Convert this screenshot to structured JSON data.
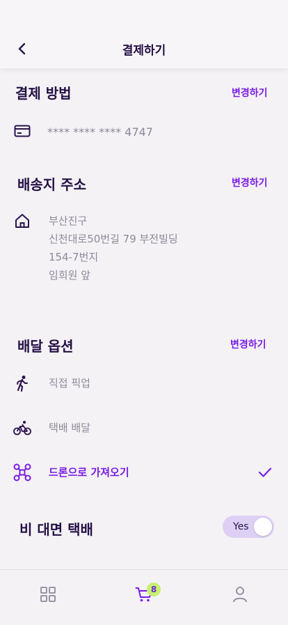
{
  "header": {
    "title": "결제하기",
    "back_icon": "chevron-left-icon"
  },
  "payment": {
    "title": "결제 방법",
    "change_label": "변경하기",
    "card_icon": "credit-card-icon",
    "card_number": "**** **** **** 4747"
  },
  "shipping": {
    "title": "배송지 주소",
    "change_label": "변경하기",
    "home_icon": "home-icon",
    "address_lines": [
      "부산진구",
      "신천대로50번길 79 부전빌딩",
      "154-7번지",
      "임희원 앞"
    ]
  },
  "delivery": {
    "title": "배달 옵션",
    "change_label": "변경하기",
    "options": [
      {
        "label": "직접 픽업",
        "icon": "walking-person-icon",
        "selected": false
      },
      {
        "label": "택배 배달",
        "icon": "bicycle-icon",
        "selected": false
      },
      {
        "label": "드론으로 가져오기",
        "icon": "drone-icon",
        "selected": true
      }
    ],
    "check_icon": "checkmark-icon"
  },
  "contactless": {
    "label": "비 대면 택배",
    "toggle_label": "Yes",
    "enabled": true
  },
  "tabbar": {
    "items": [
      {
        "icon": "grid-icon"
      },
      {
        "icon": "cart-icon",
        "active": true
      },
      {
        "icon": "user-icon"
      }
    ],
    "cart_badge": "8"
  },
  "colors": {
    "accent": "#7a1ce6",
    "text_dark": "#230f45",
    "text_muted": "#8c8a99",
    "badge": "#c6f06e",
    "toggle_bg": "#ddd0f4"
  }
}
